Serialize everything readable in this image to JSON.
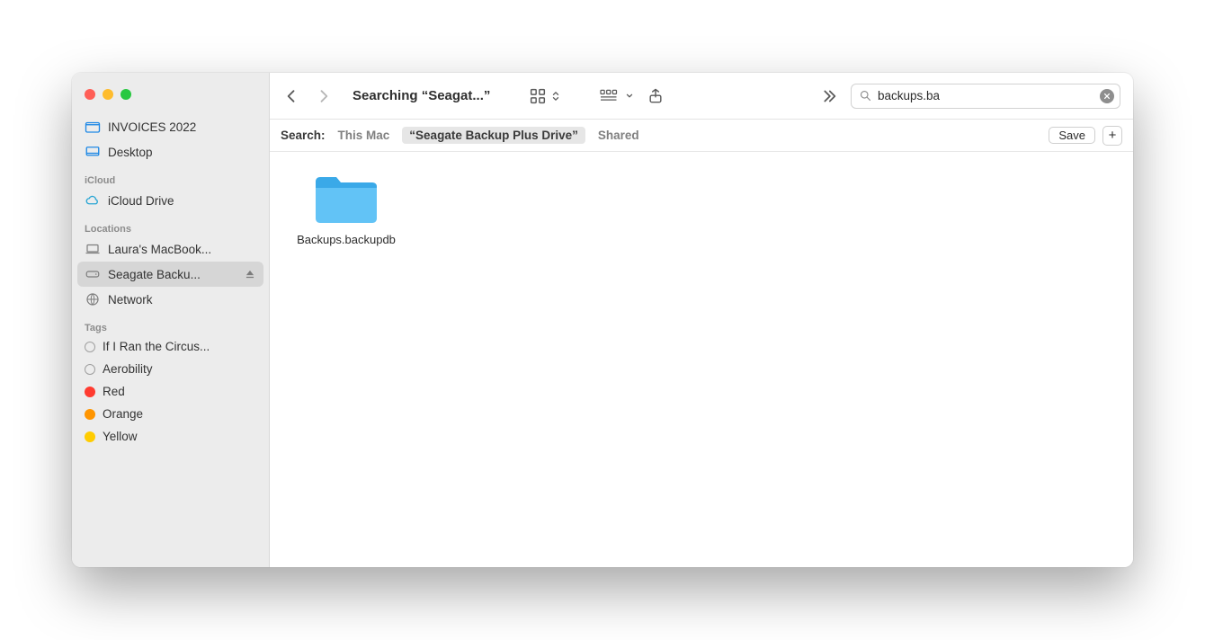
{
  "window": {
    "title": "Searching “Seagat...”"
  },
  "search": {
    "value": "backups.ba",
    "placeholder": "Search"
  },
  "sidebar": {
    "favorites": [
      {
        "label": "INVOICES 2022",
        "icon": "folder"
      },
      {
        "label": "Desktop",
        "icon": "desktop"
      }
    ],
    "icloud_label": "iCloud",
    "icloud": [
      {
        "label": "iCloud Drive",
        "icon": "cloud"
      }
    ],
    "locations_label": "Locations",
    "locations": [
      {
        "label": "Laura's MacBook...",
        "icon": "laptop",
        "selected": false,
        "ejectable": false
      },
      {
        "label": "Seagate Backu...",
        "icon": "drive",
        "selected": true,
        "ejectable": true
      },
      {
        "label": "Network",
        "icon": "globe",
        "selected": false,
        "ejectable": false
      }
    ],
    "tags_label": "Tags",
    "tags": [
      {
        "label": "If I Ran the Circus...",
        "color": "none"
      },
      {
        "label": "Aerobility",
        "color": "none"
      },
      {
        "label": "Red",
        "color": "red"
      },
      {
        "label": "Orange",
        "color": "orange"
      },
      {
        "label": "Yellow",
        "color": "yellow"
      }
    ]
  },
  "scope": {
    "label": "Search:",
    "options": [
      {
        "label": "This Mac",
        "selected": false
      },
      {
        "label": "“Seagate Backup Plus Drive”",
        "selected": true
      },
      {
        "label": "Shared",
        "selected": false
      }
    ],
    "save_label": "Save"
  },
  "results": [
    {
      "name": "Backups.backupdb",
      "type": "folder"
    }
  ]
}
